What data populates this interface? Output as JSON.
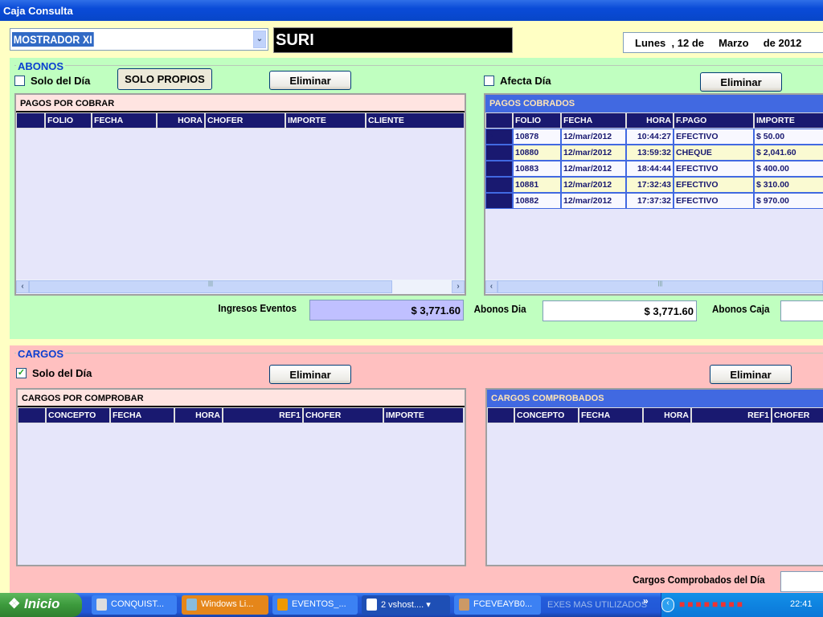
{
  "window": {
    "title": "Caja Consulta"
  },
  "header": {
    "combo_value": "MOSTRADOR XI",
    "user_name": "SURI",
    "date": {
      "weekday": "Lunes",
      "day": ", 12 de",
      "month": "Marzo",
      "year": "de 2012"
    }
  },
  "abonos": {
    "title": "ABONOS",
    "solo_del_dia": {
      "label": "Solo del Día",
      "checked": false
    },
    "solo_propios_label": "SOLO PROPIOS",
    "eliminar_left_label": "Eliminar",
    "afecta_dia": {
      "label": "Afecta Día",
      "checked": false
    },
    "eliminar_right_label": "Eliminar",
    "pagos_por_cobrar": {
      "caption": "PAGOS POR COBRAR",
      "columns": [
        "FOLIO",
        "FECHA",
        "HORA",
        "CHOFER",
        "IMPORTE",
        "CLIENTE"
      ],
      "rows": []
    },
    "pagos_cobrados": {
      "caption": "PAGOS COBRADOS",
      "columns": [
        "FOLIO",
        "FECHA",
        "HORA",
        "F.PAGO",
        "IMPORTE"
      ],
      "rows": [
        [
          "10878",
          "12/mar/2012",
          "10:44:27",
          "EFECTIVO",
          "$ 50.00"
        ],
        [
          "10880",
          "12/mar/2012",
          "13:59:32",
          "CHEQUE",
          "$ 2,041.60"
        ],
        [
          "10883",
          "12/mar/2012",
          "18:44:44",
          "EFECTIVO",
          "$ 400.00"
        ],
        [
          "10881",
          "12/mar/2012",
          "17:32:43",
          "EFECTIVO",
          "$ 310.00"
        ],
        [
          "10882",
          "12/mar/2012",
          "17:37:32",
          "EFECTIVO",
          "$ 970.00"
        ]
      ]
    },
    "ingresos_eventos_label": "Ingresos Eventos",
    "ingresos_eventos_value": "$ 3,771.60",
    "abonos_dia_label": "Abonos Dia",
    "abonos_dia_value": "$ 3,771.60",
    "abonos_caja_label": "Abonos Caja"
  },
  "cargos": {
    "title": "CARGOS",
    "solo_del_dia": {
      "label": "Solo del Día",
      "checked": true
    },
    "eliminar_left_label": "Eliminar",
    "eliminar_right_label": "Eliminar",
    "cargos_por_comprobar": {
      "caption": "CARGOS POR COMPROBAR",
      "columns": [
        "CONCEPTO",
        "FECHA",
        "HORA",
        "REF1",
        "CHOFER",
        "IMPORTE"
      ]
    },
    "cargos_comprobados": {
      "caption": "CARGOS COMPROBADOS",
      "columns": [
        "CONCEPTO",
        "FECHA",
        "HORA",
        "REF1",
        "CHOFER"
      ]
    },
    "cargos_comprobados_dia_label": "Cargos Comprobados del Día"
  },
  "taskbar": {
    "start_label": "Inicio",
    "tasks": [
      "CONQUIST...",
      "Windows Li...",
      "EVENTOS_...",
      "2  vshost....",
      "FCEVEAYB0..."
    ],
    "toolbar_label": "EXES MAS UTILIZADOS",
    "clock": "22:41"
  },
  "colors": {
    "abonos_bg": "#C0FFC0",
    "cargos_bg": "#FFC0C0",
    "grid_header": "#191970",
    "caption_blue": "#4169E1"
  }
}
